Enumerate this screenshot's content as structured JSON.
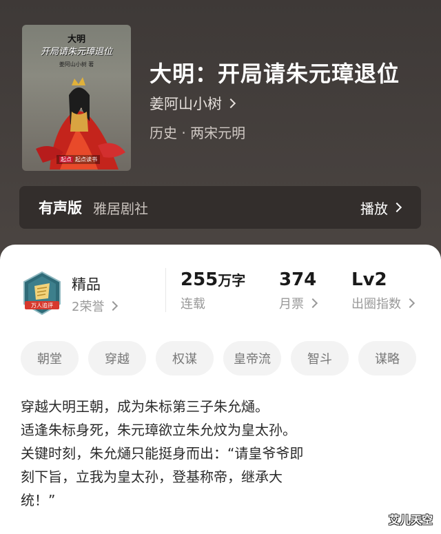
{
  "book": {
    "title": "大明：开局请朱元璋退位",
    "author": "姜阿山小树",
    "genre": "历史 · 两宋元明",
    "cover": {
      "title_line1": "大明",
      "title_line2": "开局请朱元璋退位",
      "author": "姜阿山小树 著",
      "publisher_tag": "起点",
      "publisher": "起点读书"
    }
  },
  "audio": {
    "label": "有声版",
    "studio": "雅居剧社",
    "play_label": "播放"
  },
  "badge": {
    "text": "万人追评",
    "grade": "精品",
    "honors": "2荣誉"
  },
  "stats": {
    "words_num": "255",
    "words_unit": "万字",
    "words_label": "连载",
    "tickets_num": "374",
    "tickets_label": "月票",
    "level_num": "Lv2",
    "level_label": "出圈指数"
  },
  "tags": [
    "朝堂",
    "穿越",
    "权谋",
    "皇帝流",
    "智斗",
    "谋略"
  ],
  "description": [
    "穿越大明王朝，成为朱标第三子朱允熥。",
    "适逢朱标身死，朱元璋欲立朱允炆为皇太孙。",
    "关键时刻，朱允熥只能挺身而出：“请皇爷爷即",
    "刻下旨，立我为皇太孙，登基称帝，继承大",
    "统！”"
  ],
  "watermark": "艾儿天空",
  "colors": {
    "header_bg": "#443f3c",
    "card_bg": "#ffffff",
    "tag_bg": "#f3f3f3",
    "muted": "#999999"
  }
}
